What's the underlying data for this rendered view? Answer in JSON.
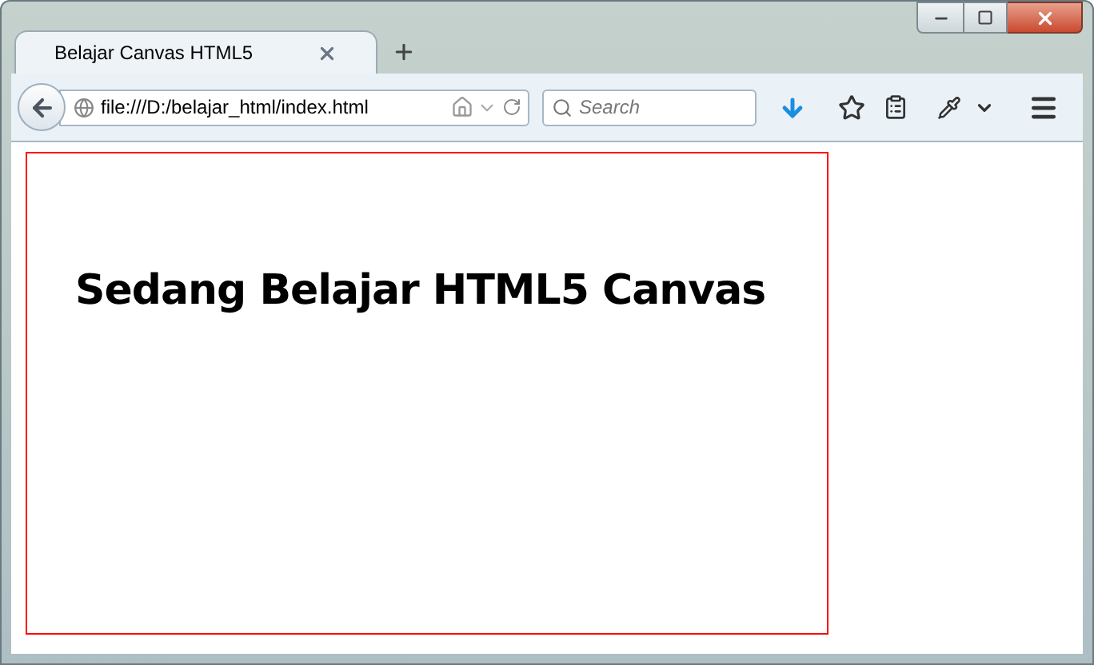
{
  "tab": {
    "title": "Belajar Canvas HTML5",
    "selected": true
  },
  "address": {
    "value": "file:///D:/belajar_html/index.html"
  },
  "search": {
    "placeholder": "Search"
  },
  "canvas": {
    "heading": "Sedang Belajar HTML5 Canvas"
  }
}
